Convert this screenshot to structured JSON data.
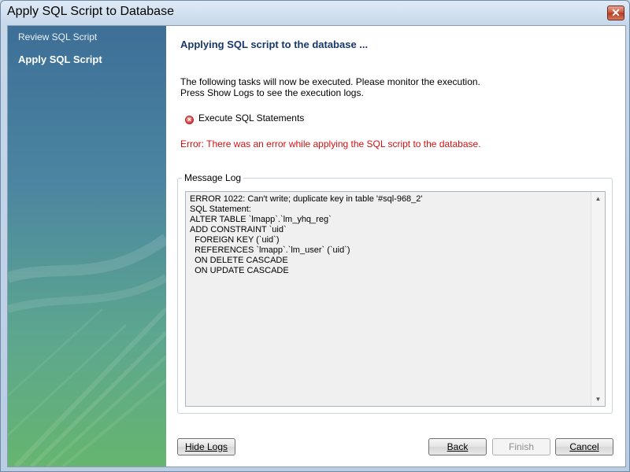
{
  "window": {
    "title": "Apply SQL Script to Database",
    "close_glyph": "✕"
  },
  "sidebar": {
    "items": [
      {
        "label": "Review SQL Script",
        "active": false
      },
      {
        "label": "Apply SQL Script",
        "active": true
      }
    ]
  },
  "main": {
    "heading": "Applying SQL script to the database ...",
    "desc_line1": "The following tasks will now be executed. Please monitor the execution.",
    "desc_line2": "Press Show Logs to see the execution logs.",
    "task": {
      "icon": "error-icon",
      "label": "Execute SQL Statements"
    },
    "error": "Error: There was an error while applying the SQL script to the database.",
    "message_log_label": "Message Log",
    "log_lines": [
      "ERROR 1022: Can't write; duplicate key in table '#sql-968_2'",
      "SQL Statement:",
      "ALTER TABLE `lmapp`.`lm_yhq_reg`",
      "ADD CONSTRAINT `uid`",
      "  FOREIGN KEY (`uid`)",
      "  REFERENCES `lmapp`.`lm_user` (`uid`)",
      "  ON DELETE CASCADE",
      "  ON UPDATE CASCADE"
    ]
  },
  "buttons": {
    "hide_logs": "Hide Logs",
    "back": "Back",
    "finish": "Finish",
    "cancel": "Cancel"
  },
  "colors": {
    "heading": "#17386a",
    "error": "#d31010"
  }
}
